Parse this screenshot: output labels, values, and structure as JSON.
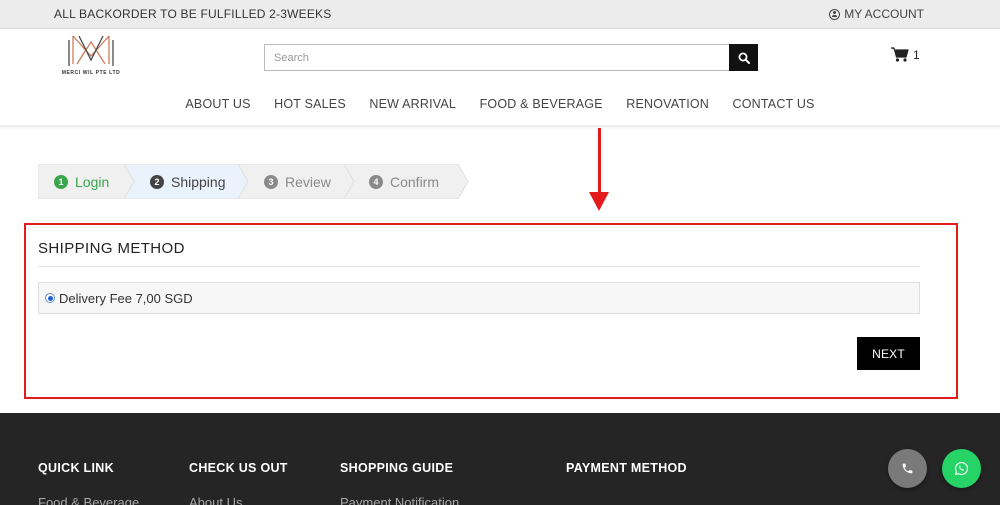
{
  "topbar": {
    "notice": "ALL BACKORDER TO BE FULFILLED 2-3WEEKS",
    "account_label": "MY ACCOUNT"
  },
  "logo": {
    "text": "MERCI WIL PTE LTD"
  },
  "search": {
    "placeholder": "Search"
  },
  "cart": {
    "count": "1"
  },
  "nav": [
    "ABOUT US",
    "HOT SALES",
    "NEW ARRIVAL",
    "FOOD & BEVERAGE",
    "RENOVATION",
    "CONTACT US"
  ],
  "steps": [
    {
      "num": "1",
      "label": "Login",
      "state": "done"
    },
    {
      "num": "2",
      "label": "Shipping",
      "state": "active"
    },
    {
      "num": "3",
      "label": "Review",
      "state": "pending"
    },
    {
      "num": "4",
      "label": "Confirm",
      "state": "pending"
    }
  ],
  "shipping": {
    "title": "SHIPPING METHOD",
    "option_label": "Delivery Fee 7,00 SGD",
    "next_label": "NEXT"
  },
  "footer": {
    "columns": [
      {
        "title": "QUICK LINK",
        "link": "Food & Beverage"
      },
      {
        "title": "CHECK US OUT",
        "link": "About Us"
      },
      {
        "title": "SHOPPING GUIDE",
        "link": "Payment Notification"
      },
      {
        "title": "PAYMENT METHOD",
        "link": ""
      }
    ]
  },
  "colors": {
    "highlight": "#e21c1c",
    "step_done": "#3aa64c",
    "step_active_bg": "#eaf2fb",
    "whatsapp": "#25d366",
    "phone_btn": "#7a7a7a"
  },
  "icons": [
    "user-icon",
    "search-icon",
    "cart-icon",
    "phone-icon",
    "whatsapp-icon"
  ]
}
